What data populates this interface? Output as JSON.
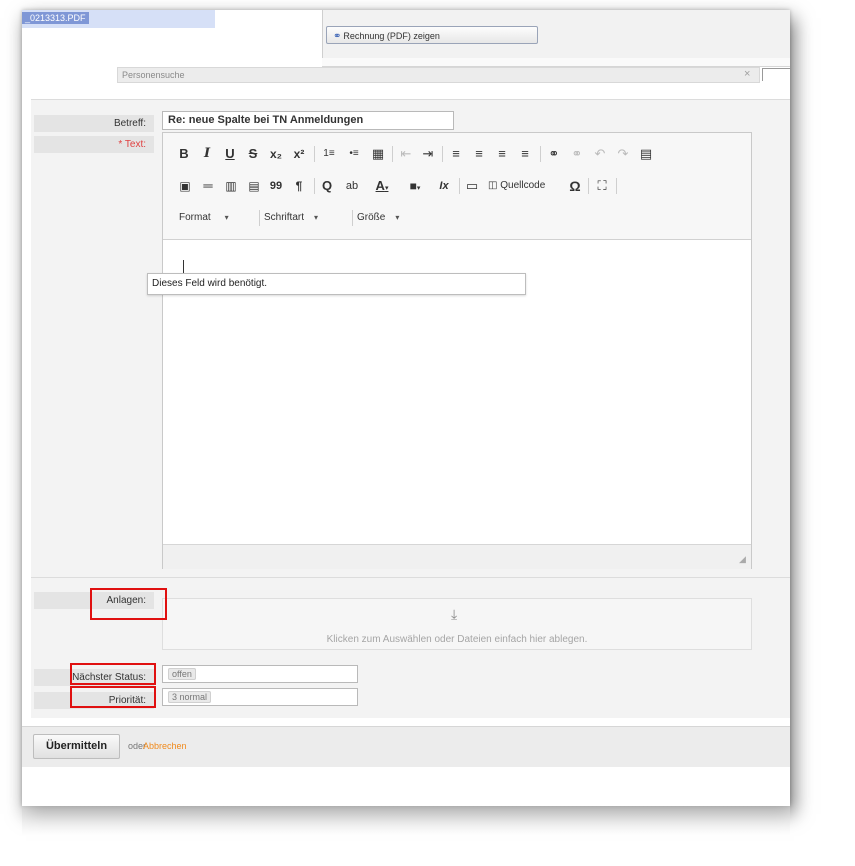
{
  "top": {
    "file_name": "_0213313.PDF",
    "pdf_button_label": "Rechnung (PDF) zeigen",
    "search_title": "Personensuche",
    "close_glyph": "×"
  },
  "form": {
    "subject_label": "Betreff:",
    "subject_value": "Re: neue Spalte bei TN Anmeldungen",
    "text_label": "* Text:",
    "tooltip": "Dieses Feld wird benötigt.",
    "attachments_label": "Anlagen:",
    "dropzone_text": "Klicken zum Auswählen oder Dateien einfach hier ablegen.",
    "status_label": "Nächster Status:",
    "status_value": "offen",
    "priority_label": "Priorität:",
    "priority_value": "3 normal"
  },
  "toolbar": {
    "row1": [
      "B",
      "I",
      "U",
      "S",
      "x₂",
      "x²",
      "1≡",
      "•≡",
      "▦",
      "⇤",
      "⇥",
      "≡",
      "≡",
      "≡",
      "≡",
      "⚭",
      "⚭",
      "↶",
      "↷",
      "▤"
    ],
    "row2": [
      "▣",
      "═",
      "▥",
      "▤",
      "99",
      "¶",
      "Q",
      "ab",
      "A",
      "■",
      "Ix",
      "▭",
      "◫"
    ],
    "source_label": "Quellcode",
    "omega": "Ω",
    "fullscreen": "⛶",
    "format_label": "Format",
    "font_label": "Schriftart",
    "size_label": "Größe"
  },
  "actions": {
    "submit_label": "Übermitteln",
    "or_label": "oder",
    "cancel_label": "Abbrechen"
  },
  "colors": {
    "required": "#e04040",
    "highlight": "#e01010",
    "cancel_link": "#f08a1c"
  }
}
